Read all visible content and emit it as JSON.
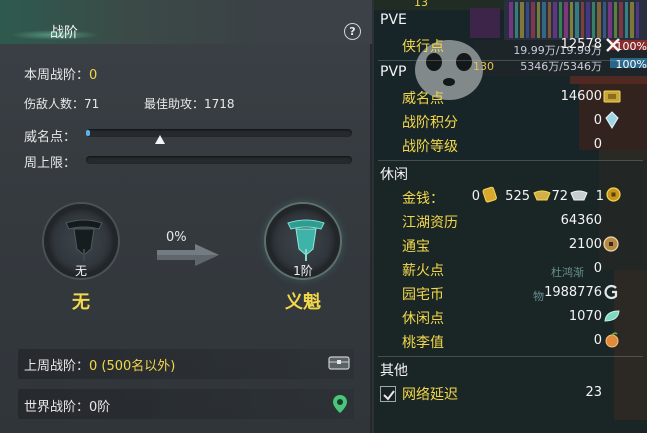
{
  "left_panel": {
    "title": "战阶",
    "help": "?",
    "weekly_rank_label": "本周战阶：",
    "weekly_rank_value": "0",
    "kills_label": "伤敌人数：",
    "kills_value": "71",
    "best_assist_label": "最佳助攻：",
    "best_assist_value": "1718",
    "prestige_label": "威名点：",
    "weekly_cap_label": "周上限：",
    "prestige_progress": 0.01,
    "prestige_marker": 0.28,
    "weekly_cap_progress": 0,
    "current_rank": {
      "badge_label": "无",
      "name": "无"
    },
    "progress_percent": "0%",
    "next_rank": {
      "badge_label": "1阶",
      "name": "义魁"
    },
    "last_week_label": "上周战阶：",
    "last_week_value": "0 (500名以外)",
    "world_rank_label": "世界战阶：",
    "world_rank_value": "0阶"
  },
  "right_panel": {
    "top_strip": "13",
    "pve": {
      "title": "PVE",
      "items": [
        {
          "label": "侠行点",
          "value": "12578",
          "icon": "x-icon"
        }
      ]
    },
    "pvp": {
      "title": "PVP",
      "items": [
        {
          "label": "威名点",
          "value": "14600",
          "icon": "ticket-icon"
        },
        {
          "label": "战阶积分",
          "value": "0",
          "icon": "crystal-icon"
        },
        {
          "label": "战阶等级",
          "value": "0",
          "icon": ""
        }
      ]
    },
    "leisure": {
      "title": "休闲",
      "money": {
        "label": "金钱：",
        "gold": "0",
        "silver": "525",
        "copper": "72",
        "fourth": "1"
      },
      "items": [
        {
          "label": "江湖资历",
          "value": "64360",
          "icon": ""
        },
        {
          "label": "通宝",
          "value": "2100",
          "icon": "coin-icon"
        },
        {
          "label": "薪火点",
          "value": "0",
          "icon": ""
        },
        {
          "label": "园宅币",
          "value": "1988776",
          "icon": "g-coin-icon"
        },
        {
          "label": "休闲点",
          "value": "1070",
          "icon": "leaf-icon"
        },
        {
          "label": "桃李值",
          "value": "0",
          "icon": "peach-icon"
        }
      ]
    },
    "other": {
      "title": "其他",
      "items": [
        {
          "label": "网络延迟",
          "value": "23",
          "checked": true
        }
      ]
    },
    "background_text": {
      "hp": "19.99万/19.99万",
      "mp": "5346万/5346万",
      "level": "130",
      "percent_a": "100%",
      "percent_b": "100%",
      "npc_name": "杜鸿渐",
      "npc_sub": "物"
    }
  },
  "colors": {
    "accent_yellow": "#f2d84a",
    "progress_blue": "#5ab4e8",
    "teal_badge": "#3fb3a7"
  }
}
